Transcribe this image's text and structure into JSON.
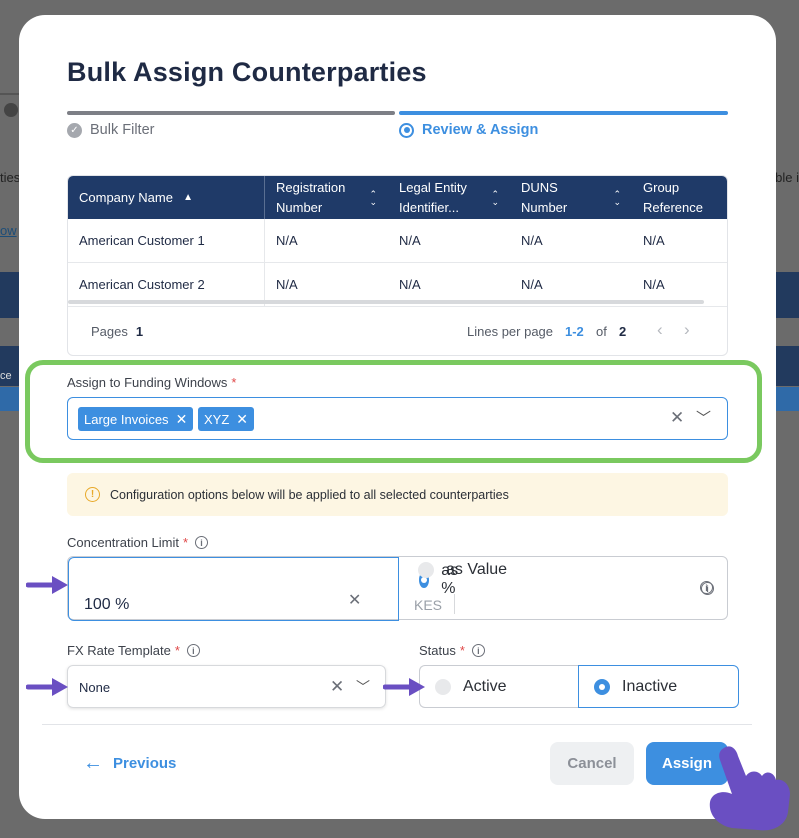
{
  "backdrop": {
    "left_text": "ties",
    "link_text": "ow",
    "band_text": "ce",
    "right_text": "ble i"
  },
  "modal": {
    "title": "Bulk Assign Counterparties",
    "steps": [
      {
        "label": "Bulk Filter",
        "state": "completed"
      },
      {
        "label": "Review & Assign",
        "state": "active"
      }
    ]
  },
  "table": {
    "columns": [
      {
        "label": "Company Name",
        "sort": "asc"
      },
      {
        "label": "Registration Number",
        "sort": "none"
      },
      {
        "label": "Legal Entity Identifier...",
        "sort": "none"
      },
      {
        "label": "DUNS Number",
        "sort": "none"
      },
      {
        "label": "Group Reference",
        "sort": "none"
      }
    ],
    "rows": [
      [
        "American Customer 1",
        "N/A",
        "N/A",
        "N/A",
        "N/A"
      ],
      [
        "American Customer 2",
        "N/A",
        "N/A",
        "N/A",
        "N/A"
      ]
    ],
    "pager": {
      "pages_label": "Pages",
      "pages_value": "1",
      "lines_per_page_label": "Lines per page",
      "range": "1-2",
      "of_label": "of",
      "total": "2"
    }
  },
  "funding_windows": {
    "label": "Assign to Funding Windows",
    "required_mark": "*",
    "chips": [
      "Large Invoices",
      "XYZ"
    ]
  },
  "notice": {
    "text": "Configuration options below will be applied to all selected counterparties"
  },
  "concentration": {
    "label": "Concentration Limit",
    "required_mark": "*",
    "option_percent": "as %",
    "option_value": "as Value",
    "selected": "as %",
    "percent_value": "100 %",
    "currency": "KES"
  },
  "fx_rate": {
    "label": "FX Rate Template",
    "required_mark": "*",
    "value": "None"
  },
  "status": {
    "label": "Status",
    "required_mark": "*",
    "options": [
      "Active",
      "Inactive"
    ],
    "selected": "Inactive"
  },
  "footer": {
    "previous": "Previous",
    "cancel": "Cancel",
    "assign": "Assign"
  },
  "colors": {
    "primary": "#3d8fe0",
    "header_navy": "#1f3a68",
    "highlight_green": "#7ac95f",
    "annotation_purple": "#6a4fc2"
  }
}
